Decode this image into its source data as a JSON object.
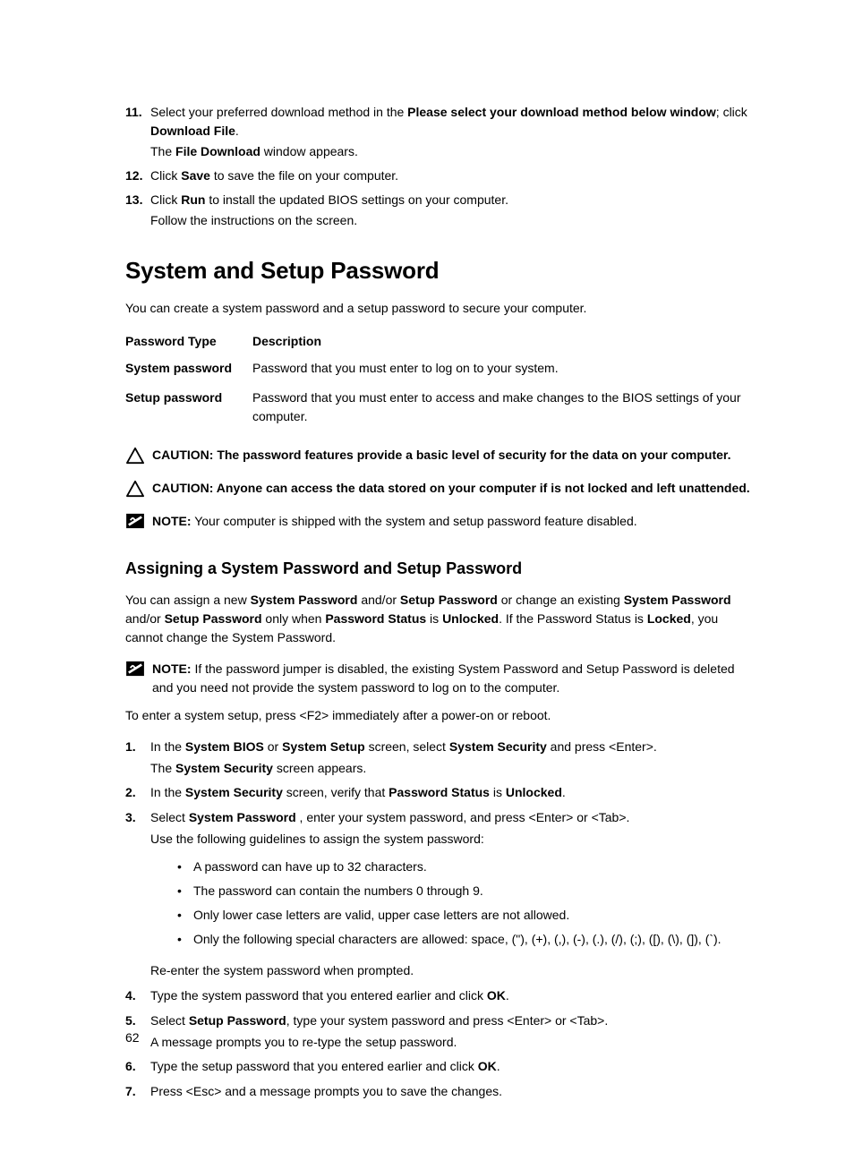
{
  "topList": {
    "item11": {
      "num": "11.",
      "l1_a": "Select your preferred download method in the ",
      "l1_b": "Please select your download method below window",
      "l1_c": "; click ",
      "l1_d": "Download File",
      "l1_e": ".",
      "l2_a": "The ",
      "l2_b": "File Download",
      "l2_c": " window appears."
    },
    "item12": {
      "num": "12.",
      "l1_a": "Click ",
      "l1_b": "Save",
      "l1_c": " to save the file on your computer."
    },
    "item13": {
      "num": "13.",
      "l1_a": "Click ",
      "l1_b": "Run",
      "l1_c": " to install the updated BIOS settings on your computer.",
      "l2": "Follow the instructions on the screen."
    }
  },
  "h1": "System and Setup Password",
  "intro": "You can create a system password and a setup password to secure your computer.",
  "table": {
    "h1": "Password Type",
    "h2": "Description",
    "r1c1": "System password",
    "r1c2": "Password that you must enter to log on to your system.",
    "r2c1": "Setup password",
    "r2c2": "Password that you must enter to access and make changes to the BIOS settings of your computer."
  },
  "caution1": "CAUTION: The password features provide a basic level of security for the data on your computer.",
  "caution2": "CAUTION: Anyone can access the data stored on your computer if is not locked and left unattended.",
  "note1_label": "NOTE:",
  "note1_text": " Your computer is shipped with the system and setup password feature disabled.",
  "h2": "Assigning a System Password and Setup Password",
  "assignIntro": {
    "a": "You can assign a new ",
    "b": "System Password",
    "c": " and/or ",
    "d": "Setup Password",
    "e": " or change an existing ",
    "f": "System Password",
    "g": " and/or ",
    "h": "Setup Password",
    "i": " only when ",
    "j": "Password Status",
    "k": " is ",
    "l": "Unlocked",
    "m": ". If the Password Status is ",
    "n": "Locked",
    "o": ", you cannot change the System Password."
  },
  "note2_label": "NOTE:",
  "note2_text": " If the password jumper is disabled, the existing System Password and Setup Password is deleted and you need not provide the system password to log on to the computer.",
  "enterSetup": "To enter a system setup, press <F2> immediately after a power-on or reboot.",
  "steps": {
    "s1": {
      "num": "1.",
      "a": "In the ",
      "b": "System BIOS",
      "c": " or ",
      "d": "System Setup",
      "e": " screen, select ",
      "f": "System Security",
      "g": " and press <Enter>.",
      "l2a": "The ",
      "l2b": "System Security",
      "l2c": " screen appears."
    },
    "s2": {
      "num": "2.",
      "a": "In the ",
      "b": "System Security",
      "c": " screen, verify that ",
      "d": "Password Status",
      "e": " is ",
      "f": "Unlocked",
      "g": "."
    },
    "s3": {
      "num": "3.",
      "a": "Select ",
      "b": "System Password",
      "c": " , enter your system password, and press <Enter> or <Tab>.",
      "l2": "Use the following guidelines to assign the system password:",
      "bul1": "A password can have up to 32 characters.",
      "bul2": "The password can contain the numbers 0 through 9.",
      "bul3": "Only lower case letters are valid, upper case letters are not allowed.",
      "bul4": "Only the following special characters are allowed: space, (\"), (+), (,), (-), (.), (/), (;), ([), (\\), (]), (`).",
      "l3": "Re-enter the system password when prompted."
    },
    "s4": {
      "num": "4.",
      "a": "Type the system password that you entered earlier and click ",
      "b": "OK",
      "c": "."
    },
    "s5": {
      "num": "5.",
      "a": "Select ",
      "b": "Setup Password",
      "c": ", type your system password and press <Enter> or <Tab>.",
      "l2": "A message prompts you to re-type the setup password."
    },
    "s6": {
      "num": "6.",
      "a": "Type the setup password that you entered earlier and click ",
      "b": "OK",
      "c": "."
    },
    "s7": {
      "num": "7.",
      "a": "Press <Esc> and a message prompts you to save the changes."
    }
  },
  "pageNum": "62"
}
